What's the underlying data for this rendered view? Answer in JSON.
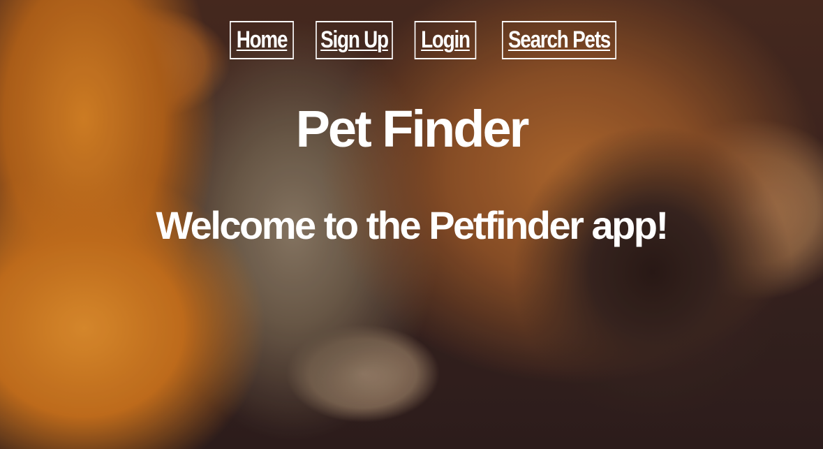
{
  "nav": {
    "items": [
      {
        "label": "Home"
      },
      {
        "label": "Sign Up"
      },
      {
        "label": "Login"
      },
      {
        "label": "Search Pets"
      }
    ]
  },
  "hero": {
    "title": "Pet Finder",
    "welcome": "Welcome to the Petfinder app!"
  },
  "colors": {
    "text": "#ffffff",
    "border": "#ffffff"
  }
}
